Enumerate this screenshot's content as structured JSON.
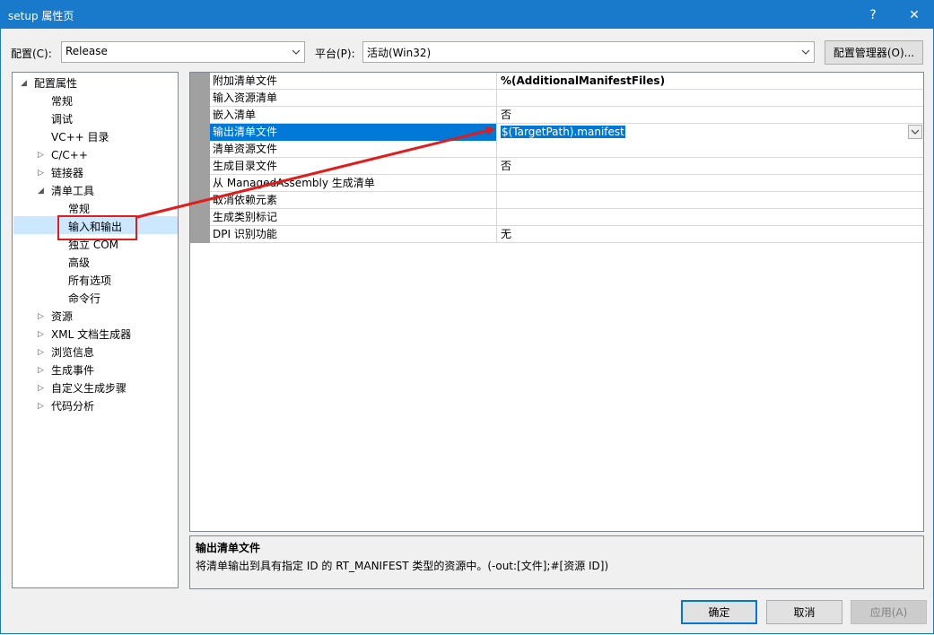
{
  "window": {
    "title": "setup 属性页",
    "help_label": "?",
    "close_label": "✕"
  },
  "config": {
    "config_label": "配置(C):",
    "config_value": "Release",
    "platform_label": "平台(P):",
    "platform_value": "活动(Win32)",
    "manager_button": "配置管理器(O)..."
  },
  "tree": {
    "items": [
      {
        "label": "配置属性",
        "expander": "◢"
      },
      {
        "label": "常规"
      },
      {
        "label": "调试"
      },
      {
        "label": "VC++ 目录"
      },
      {
        "label": "C/C++",
        "expander": "▷"
      },
      {
        "label": "链接器",
        "expander": "▷"
      },
      {
        "label": "清单工具",
        "expander": "◢"
      },
      {
        "label": "常规"
      },
      {
        "label": "输入和输出"
      },
      {
        "label": "独立 COM"
      },
      {
        "label": "高级"
      },
      {
        "label": "所有选项"
      },
      {
        "label": "命令行"
      },
      {
        "label": "资源",
        "expander": "▷"
      },
      {
        "label": "XML 文档生成器",
        "expander": "▷"
      },
      {
        "label": "浏览信息",
        "expander": "▷"
      },
      {
        "label": "生成事件",
        "expander": "▷"
      },
      {
        "label": "自定义生成步骤",
        "expander": "▷"
      },
      {
        "label": "代码分析",
        "expander": "▷"
      }
    ]
  },
  "grid": {
    "rows": [
      {
        "name": "附加清单文件",
        "value": "%(AdditionalManifestFiles)"
      },
      {
        "name": "输入资源清单",
        "value": ""
      },
      {
        "name": "嵌入清单",
        "value": "否"
      },
      {
        "name": "输出清单文件",
        "value": "$(TargetPath).manifest"
      },
      {
        "name": "清单资源文件",
        "value": ""
      },
      {
        "name": "生成目录文件",
        "value": "否"
      },
      {
        "name": "从 ManagedAssembly 生成清单",
        "value": ""
      },
      {
        "name": "取消依赖元素",
        "value": ""
      },
      {
        "name": "生成类别标记",
        "value": ""
      },
      {
        "name": "DPI 识别功能",
        "value": "无"
      }
    ]
  },
  "description": {
    "title": "输出清单文件",
    "text": "将清单输出到具有指定 ID 的 RT_MANIFEST 类型的资源中。(-out:[文件];#[资源 ID])"
  },
  "buttons": {
    "ok": "确定",
    "cancel": "取消",
    "apply": "应用(A)"
  },
  "colors": {
    "accent": "#0078d7",
    "titlebar": "#1979ca",
    "annotation_red": "#e21b1b"
  }
}
